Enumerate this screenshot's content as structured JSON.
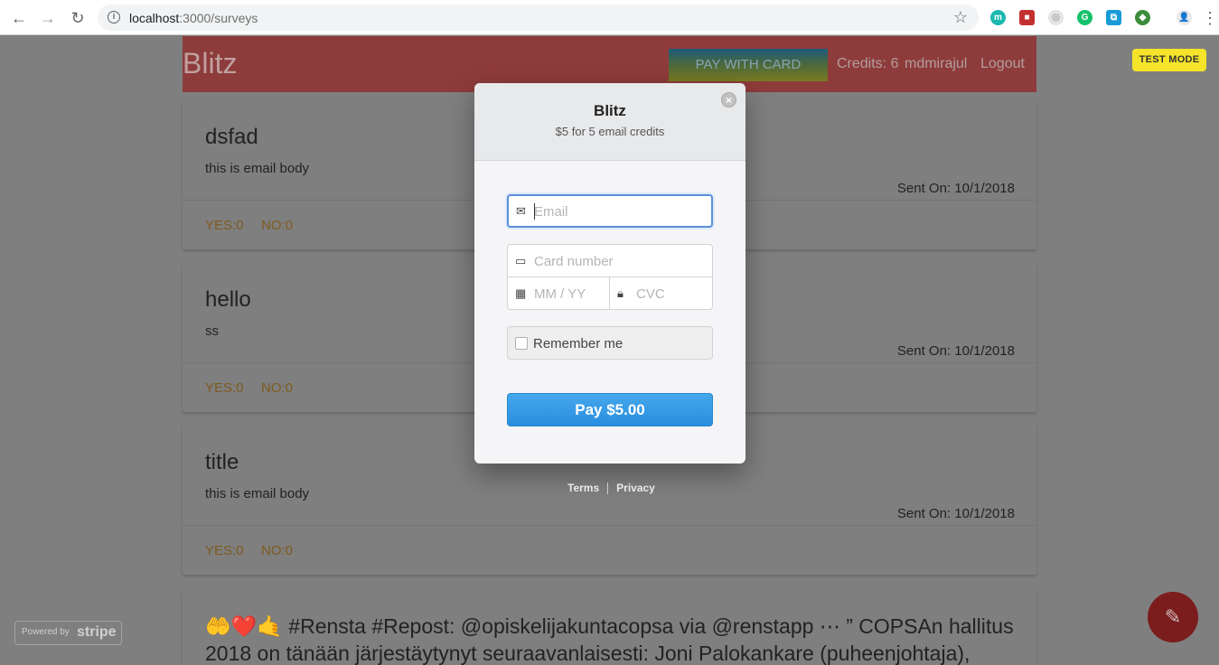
{
  "browser": {
    "url_host": "localhost",
    "url_path": ":3000/surveys"
  },
  "header": {
    "brand": "Blitz",
    "pay_button": "PAY WITH CARD",
    "credits": "Credits: 6",
    "username": "mdmirajul",
    "logout": "Logout"
  },
  "test_mode": "TEST MODE",
  "surveys": [
    {
      "title": "dsfad",
      "body": "this is email body",
      "sent": "Sent On: 10/1/2018",
      "yes": "YES:0",
      "no": "NO:0"
    },
    {
      "title": "hello",
      "body": "ss",
      "sent": "Sent On: 10/1/2018",
      "yes": "YES:0",
      "no": "NO:0"
    },
    {
      "title": "title",
      "body": "this is email body",
      "sent": "Sent On: 10/1/2018",
      "yes": "YES:0",
      "no": "NO:0"
    },
    {
      "title": "🤲❤️🤙 #Rensta #Repost: @opiskelijakuntacopsa via @renstapp ⋯ ” COPSAn hallitus 2018 on tänään järjestäytynyt seuraavanlaisesti: Joni Palokankare (puheenjohtaja),"
    }
  ],
  "modal": {
    "title": "Blitz",
    "subtitle": "$5 for 5 email credits",
    "email_placeholder": "Email",
    "card_placeholder": "Card number",
    "expiry_placeholder": "MM / YY",
    "cvc_placeholder": "CVC",
    "remember_label": "Remember me",
    "pay_button": "Pay $5.00",
    "terms": "Terms",
    "privacy": "Privacy"
  },
  "stripe_badge": {
    "prefix": "Powered by",
    "brand": "stripe"
  },
  "icons": {
    "close": "close-icon",
    "email": "envelope-icon",
    "card": "credit-card-icon",
    "calendar": "calendar-icon",
    "lock": "lock-icon",
    "edit": "pencil-icon"
  },
  "colors": {
    "header_bg": "#8e3b3b",
    "pay_button_bg": "#2a8ee0",
    "test_mode_bg": "#f5e42a",
    "fab_bg": "#7b1d1d"
  }
}
